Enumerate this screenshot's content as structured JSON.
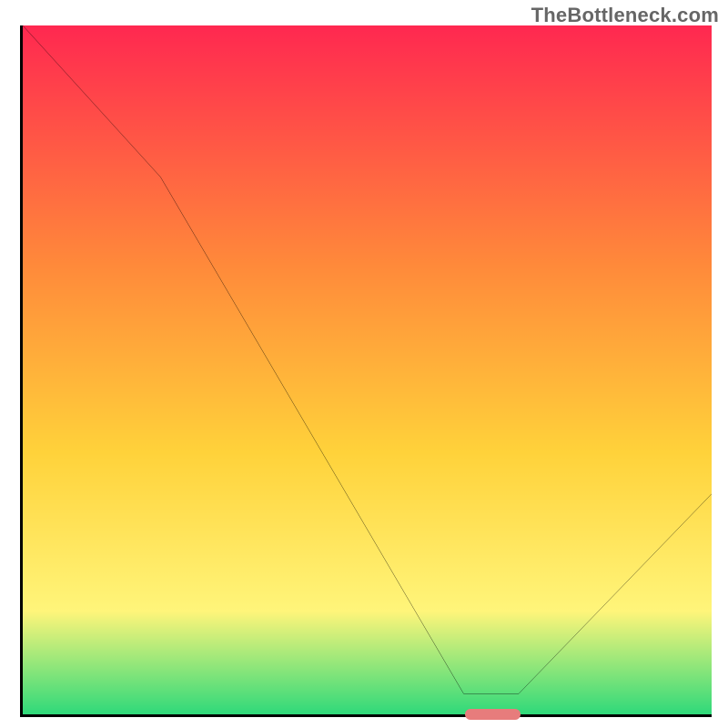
{
  "watermark": "TheBottleneck.com",
  "colors": {
    "gradient_top": "#ff2850",
    "gradient_mid1": "#ff8a3a",
    "gradient_mid2": "#ffd23a",
    "gradient_mid3": "#fff57a",
    "gradient_bottom": "#2fd97a",
    "axis": "#000000",
    "curve": "#000000",
    "marker": "#e77c7c"
  },
  "chart_data": {
    "type": "line",
    "title": "",
    "xlabel": "",
    "ylabel": "",
    "xlim": [
      0,
      100
    ],
    "ylim": [
      0,
      100
    ],
    "series": [
      {
        "name": "bottleneck-curve",
        "x": [
          0,
          20,
          64,
          72,
          100
        ],
        "values": [
          100,
          78,
          3,
          3,
          32
        ]
      }
    ],
    "annotations": [
      {
        "name": "optimal-range-marker",
        "x_start": 64,
        "x_end": 72,
        "y": 0
      }
    ]
  }
}
